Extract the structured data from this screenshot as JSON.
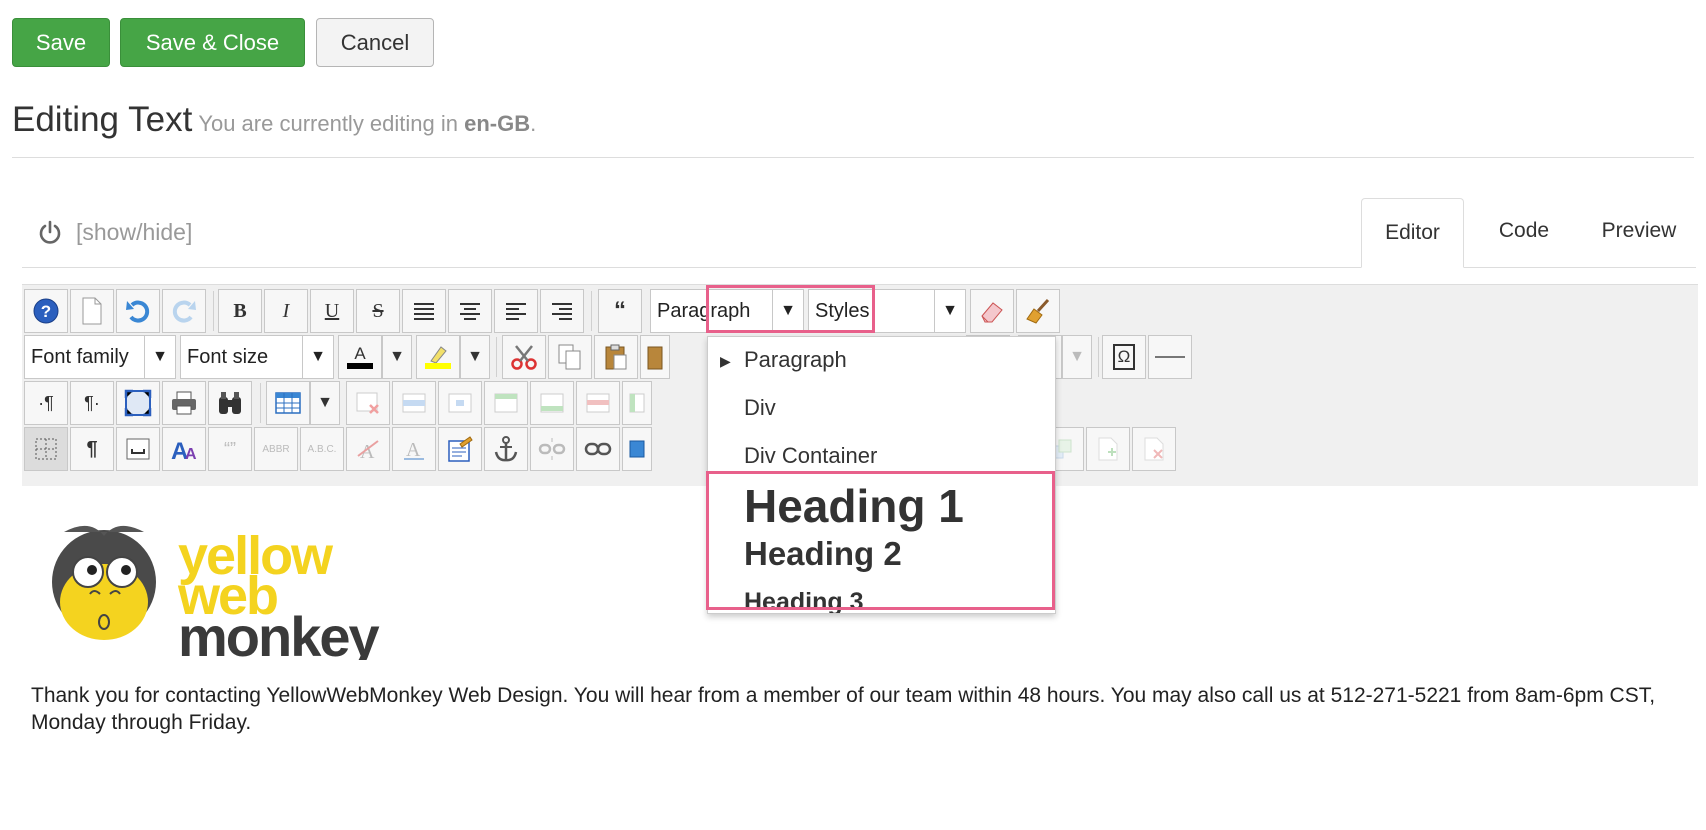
{
  "actions": {
    "save": "Save",
    "save_close": "Save & Close",
    "cancel": "Cancel"
  },
  "header": {
    "title": "Editing Text",
    "subtitle_prefix": "You are currently editing in ",
    "language": "en-GB",
    "subtitle_suffix": "."
  },
  "editor_panel": {
    "toggle_label": "[show/hide]",
    "tabs": [
      {
        "label": "Editor",
        "active": true
      },
      {
        "label": "Code"
      },
      {
        "label": "Preview"
      }
    ]
  },
  "toolbar": {
    "format_select": "Paragraph",
    "styles_select": "Styles",
    "font_family": "Font family",
    "font_size": "Font size",
    "superscript": "A²",
    "omega": "Ω",
    "bold": "B",
    "italic": "I",
    "underline": "U",
    "strike": "S",
    "quote": "“",
    "font_color_glyph": "A",
    "pilcrow": "¶",
    "ltr": "·¶",
    "rtl": "¶·",
    "abbr": "ABBR",
    "acronym": "A.B.C.",
    "cite": "“”",
    "font_color_hex": "#000000",
    "highlight_color_hex": "#ffff00"
  },
  "format_dropdown": {
    "items": [
      "Paragraph",
      "Div",
      "Div Container",
      "Heading 1",
      "Heading 2",
      "Heading 3"
    ],
    "selected": "Paragraph"
  },
  "content": {
    "logo_text": [
      "yellow",
      "web",
      "monkey"
    ],
    "body": "Thank you for contacting YellowWebMonkey Web Design.  You will hear from a member of our team within 48 hours.  You may also call us at 512-271-5221 from 8am-6pm CST, Monday through Friday."
  },
  "colors": {
    "green": "#46a546",
    "highlight": "#e8608b",
    "logo_yellow": "#f4d31f",
    "logo_gray": "#3a3a3a"
  }
}
